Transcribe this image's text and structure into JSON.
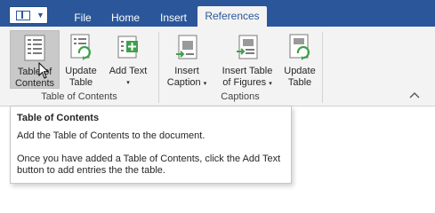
{
  "tabs": {
    "file": "File",
    "home": "Home",
    "insert": "Insert",
    "references": "References"
  },
  "ribbon": {
    "toc": {
      "line1": "Table of",
      "line2": "Contents",
      "icon": "table-of-contents-icon"
    },
    "update_table": {
      "line1": "Update",
      "line2": "Table",
      "icon": "update-table-icon"
    },
    "add_text": {
      "line1": "Add Text",
      "arrow": "▾",
      "icon": "add-text-icon"
    },
    "insert_caption": {
      "line1": "Insert",
      "line2": "Caption",
      "arrow": "▾",
      "icon": "insert-caption-icon"
    },
    "insert_tof": {
      "line1": "Insert Table",
      "line2": "of Figures",
      "arrow": "▾",
      "icon": "insert-table-of-figures-icon"
    },
    "update_table2": {
      "line1": "Update",
      "line2": "Table",
      "icon": "update-table-icon"
    },
    "groups": {
      "toc": "Table of Contents",
      "captions": "Captions"
    }
  },
  "tooltip": {
    "title": "Table of Contents",
    "line1": "Add the Table of Contents to the document.",
    "line2": "Once you have added a Table of Contents, click the Add Text",
    "line3": "button to add entries the the table."
  },
  "colors": {
    "accent": "#2b579a",
    "ribbon": "#f3f3f3",
    "pressed": "#c9c9c9",
    "green": "#3fa04b"
  }
}
